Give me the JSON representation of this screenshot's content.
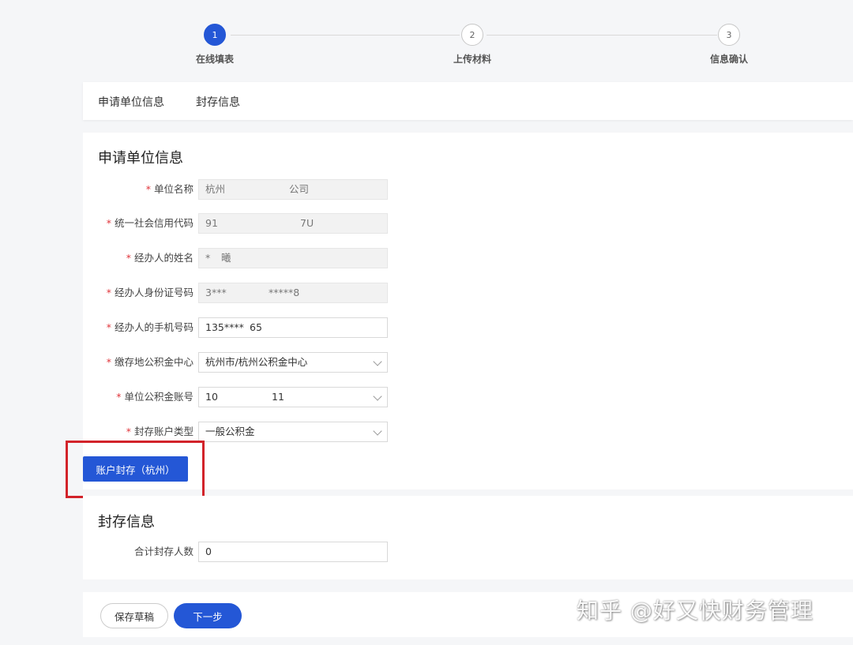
{
  "steps": [
    {
      "num": "1",
      "label": "在线填表"
    },
    {
      "num": "2",
      "label": "上传材料"
    },
    {
      "num": "3",
      "label": "信息确认"
    }
  ],
  "tabs": [
    "申请单位信息",
    "封存信息"
  ],
  "section1": {
    "title": "申请单位信息",
    "fields": {
      "company_name": {
        "label": "单位名称",
        "value_prefix": "杭州",
        "value_suffix": "公司"
      },
      "credit_code": {
        "label": "统一社会信用代码",
        "value_prefix": "91",
        "value_suffix": "7U"
      },
      "handler_name": {
        "label": "经办人的姓名",
        "value_prefix": "*",
        "value_suffix": "曦"
      },
      "id_number": {
        "label": "经办人身份证号码",
        "value_prefix": "3***",
        "value_suffix": "*****8"
      },
      "phone": {
        "label": "经办人的手机号码",
        "value_prefix": "135****",
        "value_suffix": "65"
      },
      "fund_center": {
        "label": "缴存地公积金中心",
        "value": "杭州市/杭州公积金中心"
      },
      "fund_account": {
        "label": "单位公积金账号",
        "value_prefix": "10",
        "value_suffix": "11"
      },
      "account_type": {
        "label": "封存账户类型",
        "value": "一般公积金"
      }
    },
    "action_button": "账户封存（杭州）"
  },
  "section2": {
    "title": "封存信息",
    "total_label": "合计封存人数",
    "total_value": "0"
  },
  "footer": {
    "save_draft": "保存草稿",
    "next": "下一步"
  },
  "watermark": "知乎 @好又快财务管理",
  "colors": {
    "primary": "#2457d6",
    "required": "#e0353b",
    "highlight": "#d2232a"
  }
}
